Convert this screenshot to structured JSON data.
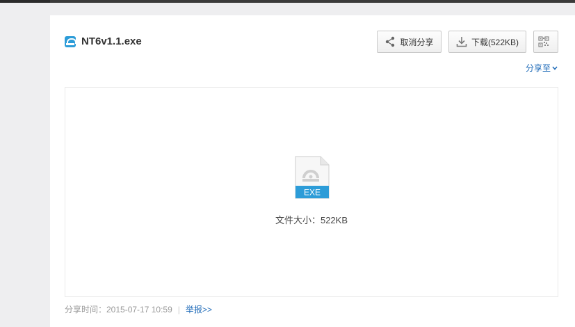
{
  "file": {
    "name": "NT6v1.1.exe",
    "type_label": "EXE",
    "size_text": "文件大小：522KB"
  },
  "toolbar": {
    "cancel_share_label": "取消分享",
    "download_label": "下载(522KB)",
    "share_to_label": "分享至"
  },
  "footer": {
    "share_time": "分享时间：2015-07-17 10:59",
    "separator": "|",
    "report_label": "举报>>"
  },
  "colors": {
    "accent": "#2c9cd8",
    "link": "#1e6ab8",
    "background": "#eeeef0"
  }
}
